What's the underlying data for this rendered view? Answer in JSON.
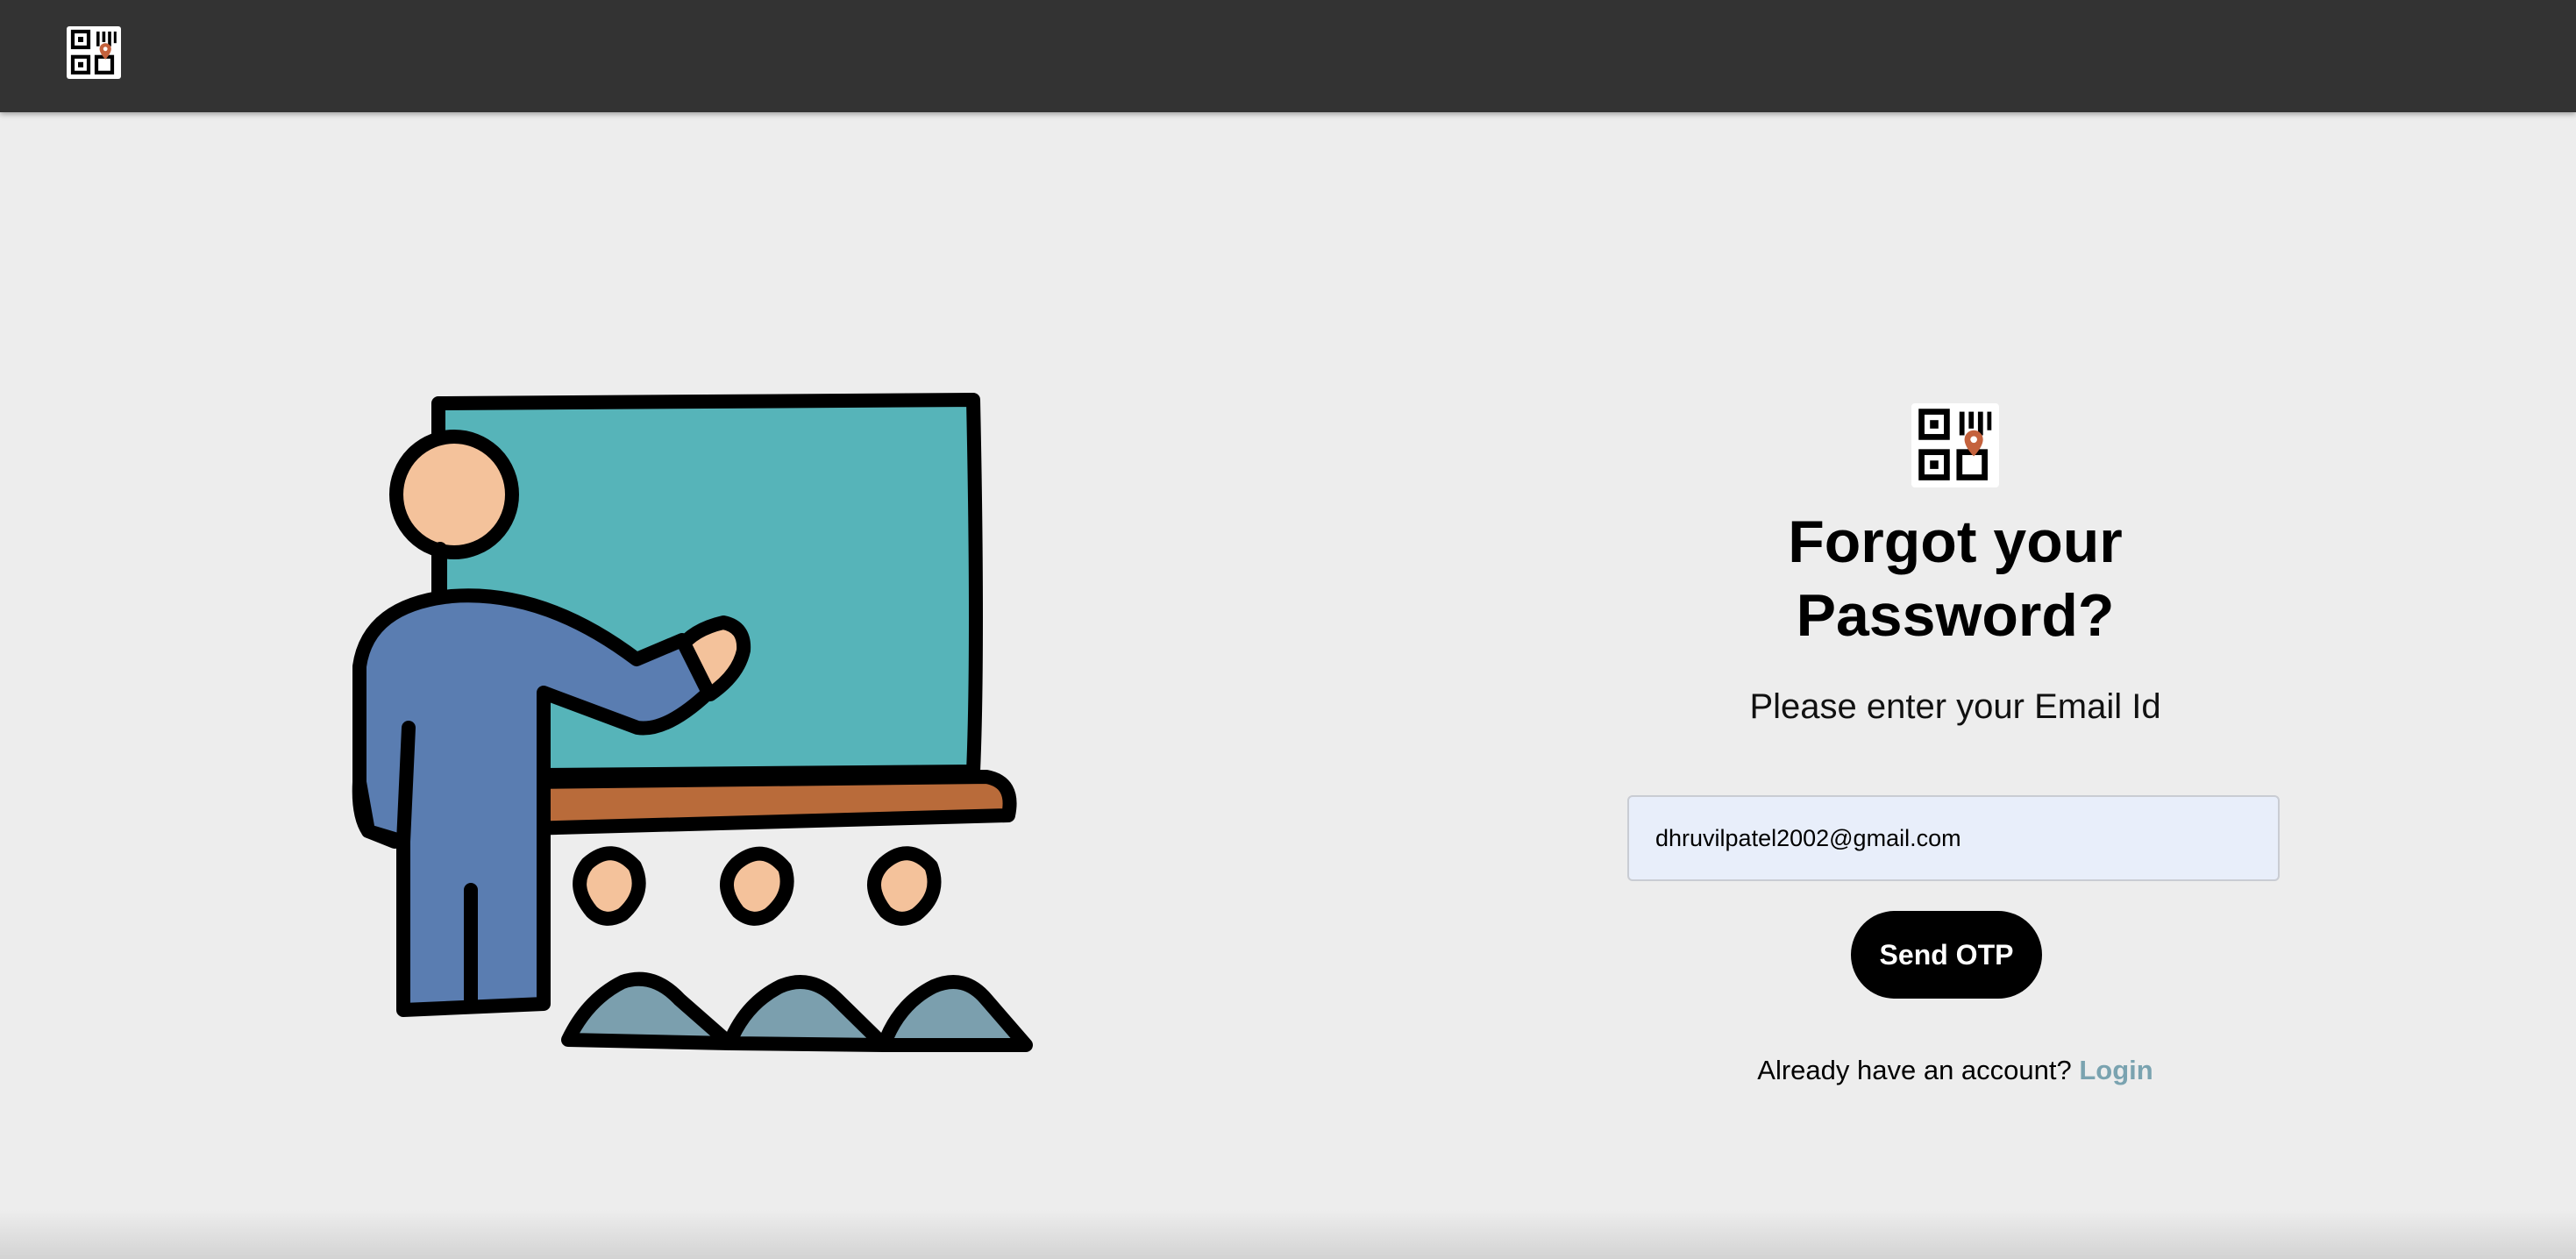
{
  "header": {
    "logo_icon": "qr-location-logo-icon"
  },
  "illustration": {
    "icon": "teacher-classroom-illustration",
    "colors": {
      "board": "#56b4b9",
      "skin": "#f4c29b",
      "shirt": "#5a7db1",
      "ledge": "#b96b3a",
      "audience": "#7b9fae"
    }
  },
  "form": {
    "logo_icon": "qr-location-logo-icon",
    "title_line1": "Forgot your",
    "title_line2": "Password?",
    "subtitle": "Please enter your Email Id",
    "email_value": "dhruvilpatel2002@gmail.com",
    "submit_label": "Send OTP",
    "footer_prompt": "Already have an account?",
    "login_label": "Login",
    "accent_color": "#7aa3b0"
  }
}
